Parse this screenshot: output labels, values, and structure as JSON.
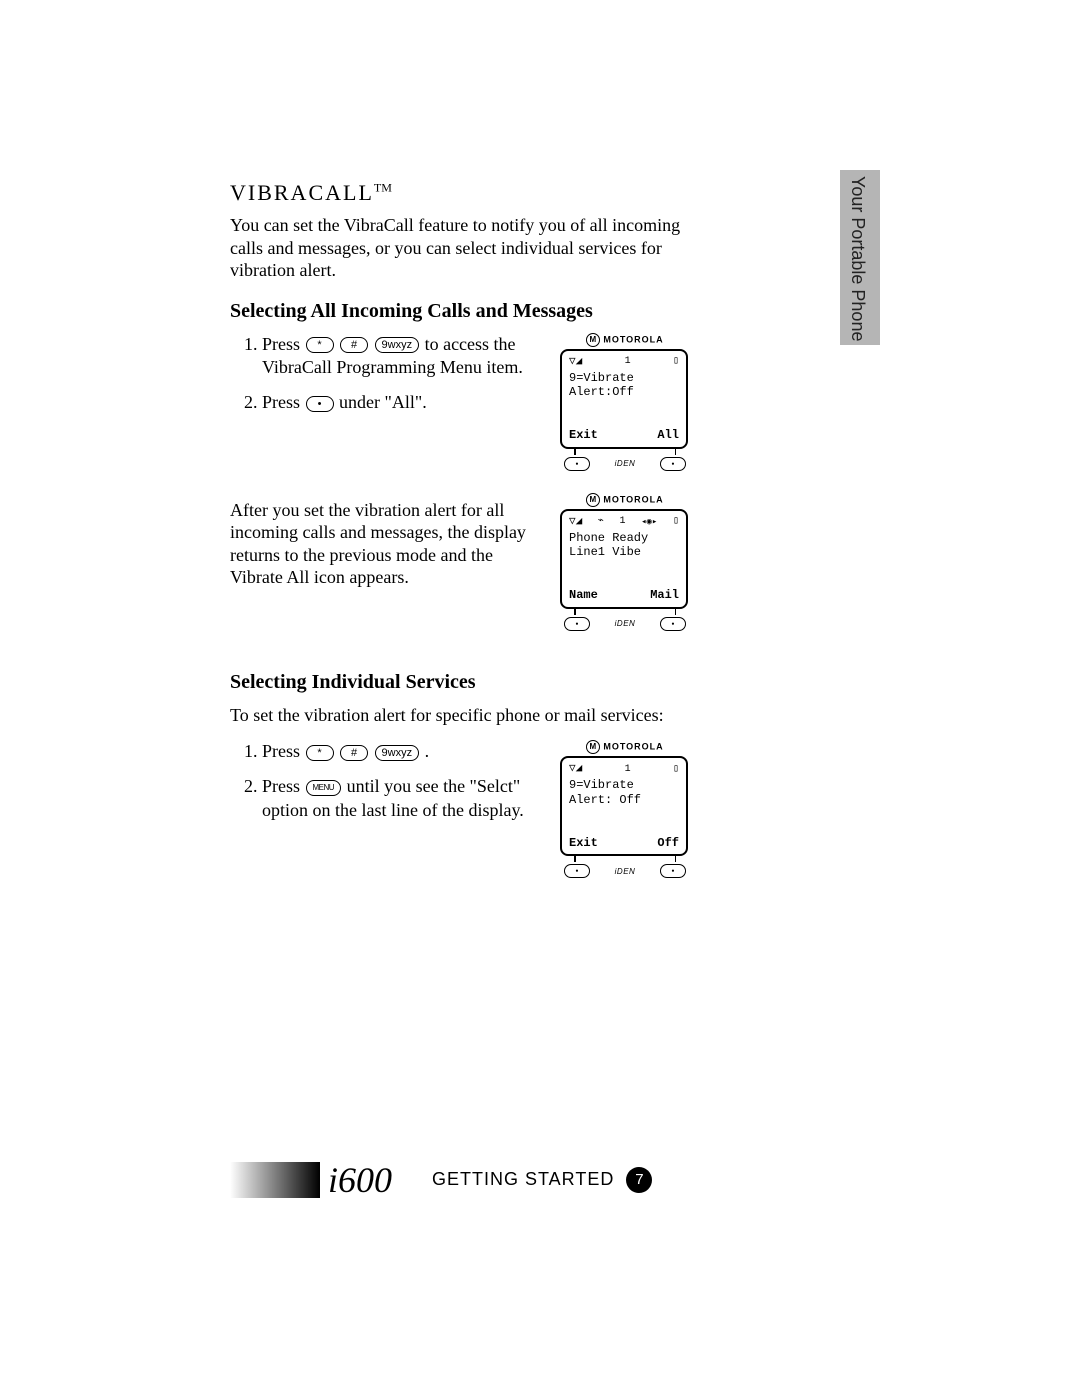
{
  "sideTab": "Your Portable Phone",
  "title": "VIBRACALL",
  "titleTM": "TM",
  "intro": "You can set the VibraCall feature to notify you of all incoming calls and messages, or you can select individual services for vibration alert.",
  "section1": {
    "heading": "Selecting All Incoming Calls and Messages",
    "step1_pre": "Press ",
    "step1_post": " to access the VibraCall Programming Menu item.",
    "step2_pre": "Press ",
    "step2_post": " under \"All\".",
    "after": "After you set the vibration alert for all incoming calls and messages, the display returns to the previous mode and the Vibrate All icon appears."
  },
  "section2": {
    "heading": "Selecting Individual Services",
    "intro": "To set the vibration alert for specific phone or mail services:",
    "step1_pre": "Press ",
    "step1_post": ".",
    "step2_pre": "Press ",
    "step2_post": " until you see the \"Selct\" option on the last line of the display."
  },
  "keys": {
    "star": "*",
    "hash": "#",
    "nine": "9wxyz",
    "menu": "MENU",
    "dot": "•"
  },
  "phone1": {
    "brand": "MOTOROLA",
    "statusNum": "1",
    "line1": "9=Vibrate",
    "line2": "Alert:Off",
    "skLeft": "Exit",
    "skRight": "All",
    "iden": "iDEN"
  },
  "phone2": {
    "brand": "MOTOROLA",
    "statusNum": "1",
    "line1": "Phone Ready",
    "line2": "Line1 Vibe",
    "skLeft": "Name",
    "skRight": "Mail",
    "iden": "iDEN"
  },
  "phone3": {
    "brand": "MOTOROLA",
    "statusNum": "1",
    "line1": "9=Vibrate",
    "line2": "Alert: Off",
    "skLeft": "Exit",
    "skRight": "Off",
    "iden": "iDEN"
  },
  "footer": {
    "model": "i600",
    "label": "GETTING STARTED",
    "page": "7"
  },
  "icons": {
    "signal": "▽◢",
    "battery": "▯",
    "vibe": "⌁"
  }
}
